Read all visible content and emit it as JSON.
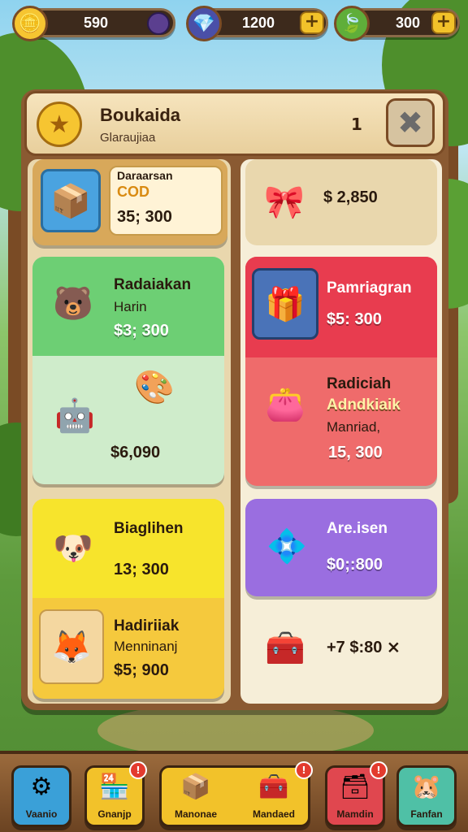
{
  "currency": {
    "coins": "590",
    "gems": "1200",
    "leaves": "300",
    "coin_icon": "coin-icon",
    "gem_icon": "gem-icon",
    "leaf_icon": "leaf-icon"
  },
  "shop": {
    "title": "Boukaida",
    "subtitle": "Glaraujiaa",
    "counter": "1",
    "close_icon": "close-icon"
  },
  "cards": {
    "top_left": {
      "name": "Daraarsan",
      "sub": "COD",
      "price": "35; 300"
    },
    "top_right": {
      "price": "$ 2,850"
    },
    "green": {
      "name": "Radaiakan",
      "sub": "Harin",
      "price": "$3; 300",
      "price2": "$6,090"
    },
    "red": {
      "name": "Pamriagran",
      "price": "$5: 300",
      "name2": "Radiciah",
      "sub2": "Adndkiaik",
      "sub3": "Manriad,",
      "price2": "15, 300"
    },
    "yellow": {
      "name": "Biaglihen",
      "price": "13; 300",
      "name2": "Hadiriiak",
      "sub2": "Menninanj",
      "price2": "$5; 900"
    },
    "purple": {
      "name": "Are.isen",
      "price": "$0;:800"
    },
    "bottom_right": {
      "price": "+7 $:80 ⨯"
    }
  },
  "nav": [
    {
      "label": "Vaanio",
      "icon": "gear-icon",
      "color": "#3aa0d8",
      "badge": ""
    },
    {
      "label": "Gnanjp",
      "icon": "shop-icon",
      "color": "#f2c22a",
      "badge": "!"
    },
    {
      "label": "Manonae",
      "icon": "box-icon",
      "color": "#f2c22a",
      "badge": ""
    },
    {
      "label": "Mandaed",
      "icon": "chest-icon",
      "color": "#f2c22a",
      "badge": "!"
    },
    {
      "label": "Mamdin",
      "icon": "crate-icon",
      "color": "#e0474f",
      "badge": "!"
    },
    {
      "label": "Fanfan",
      "icon": "character-icon",
      "color": "#4fc0a6",
      "badge": ""
    }
  ]
}
